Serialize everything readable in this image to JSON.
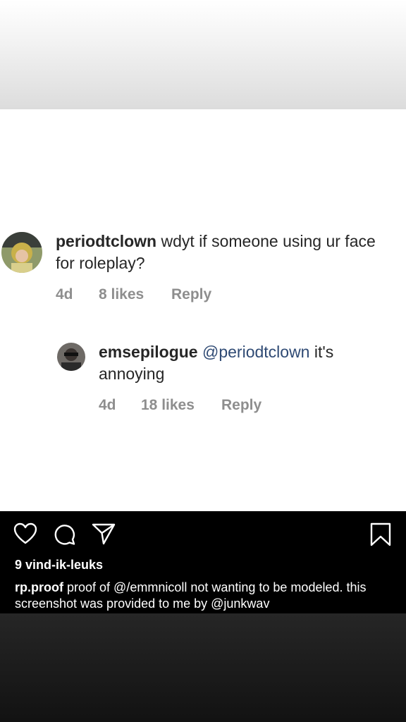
{
  "comment": {
    "username": "periodtclown",
    "text": " wdyt if someone using ur face for roleplay?",
    "time": "4d",
    "likes": "8 likes",
    "reply": "Reply"
  },
  "reply_comment": {
    "username": "emsepilogue",
    "mention": "@periodtclown",
    "text": " it's annoying",
    "time": "4d",
    "likes": "18 likes",
    "reply": "Reply"
  },
  "post": {
    "likes_count": "9 vind-ik-leuks",
    "caption_user": "rp.proof",
    "caption_text": " proof of @/emmnicoll not wanting to be modeled. this screenshot was provided to me by @junkwav"
  },
  "icons": [
    "heart-icon",
    "comment-icon",
    "share-icon",
    "bookmark-icon"
  ],
  "colors": {
    "mention": "#2f4a74",
    "meta": "#8e8e8e",
    "text": "#262626"
  }
}
